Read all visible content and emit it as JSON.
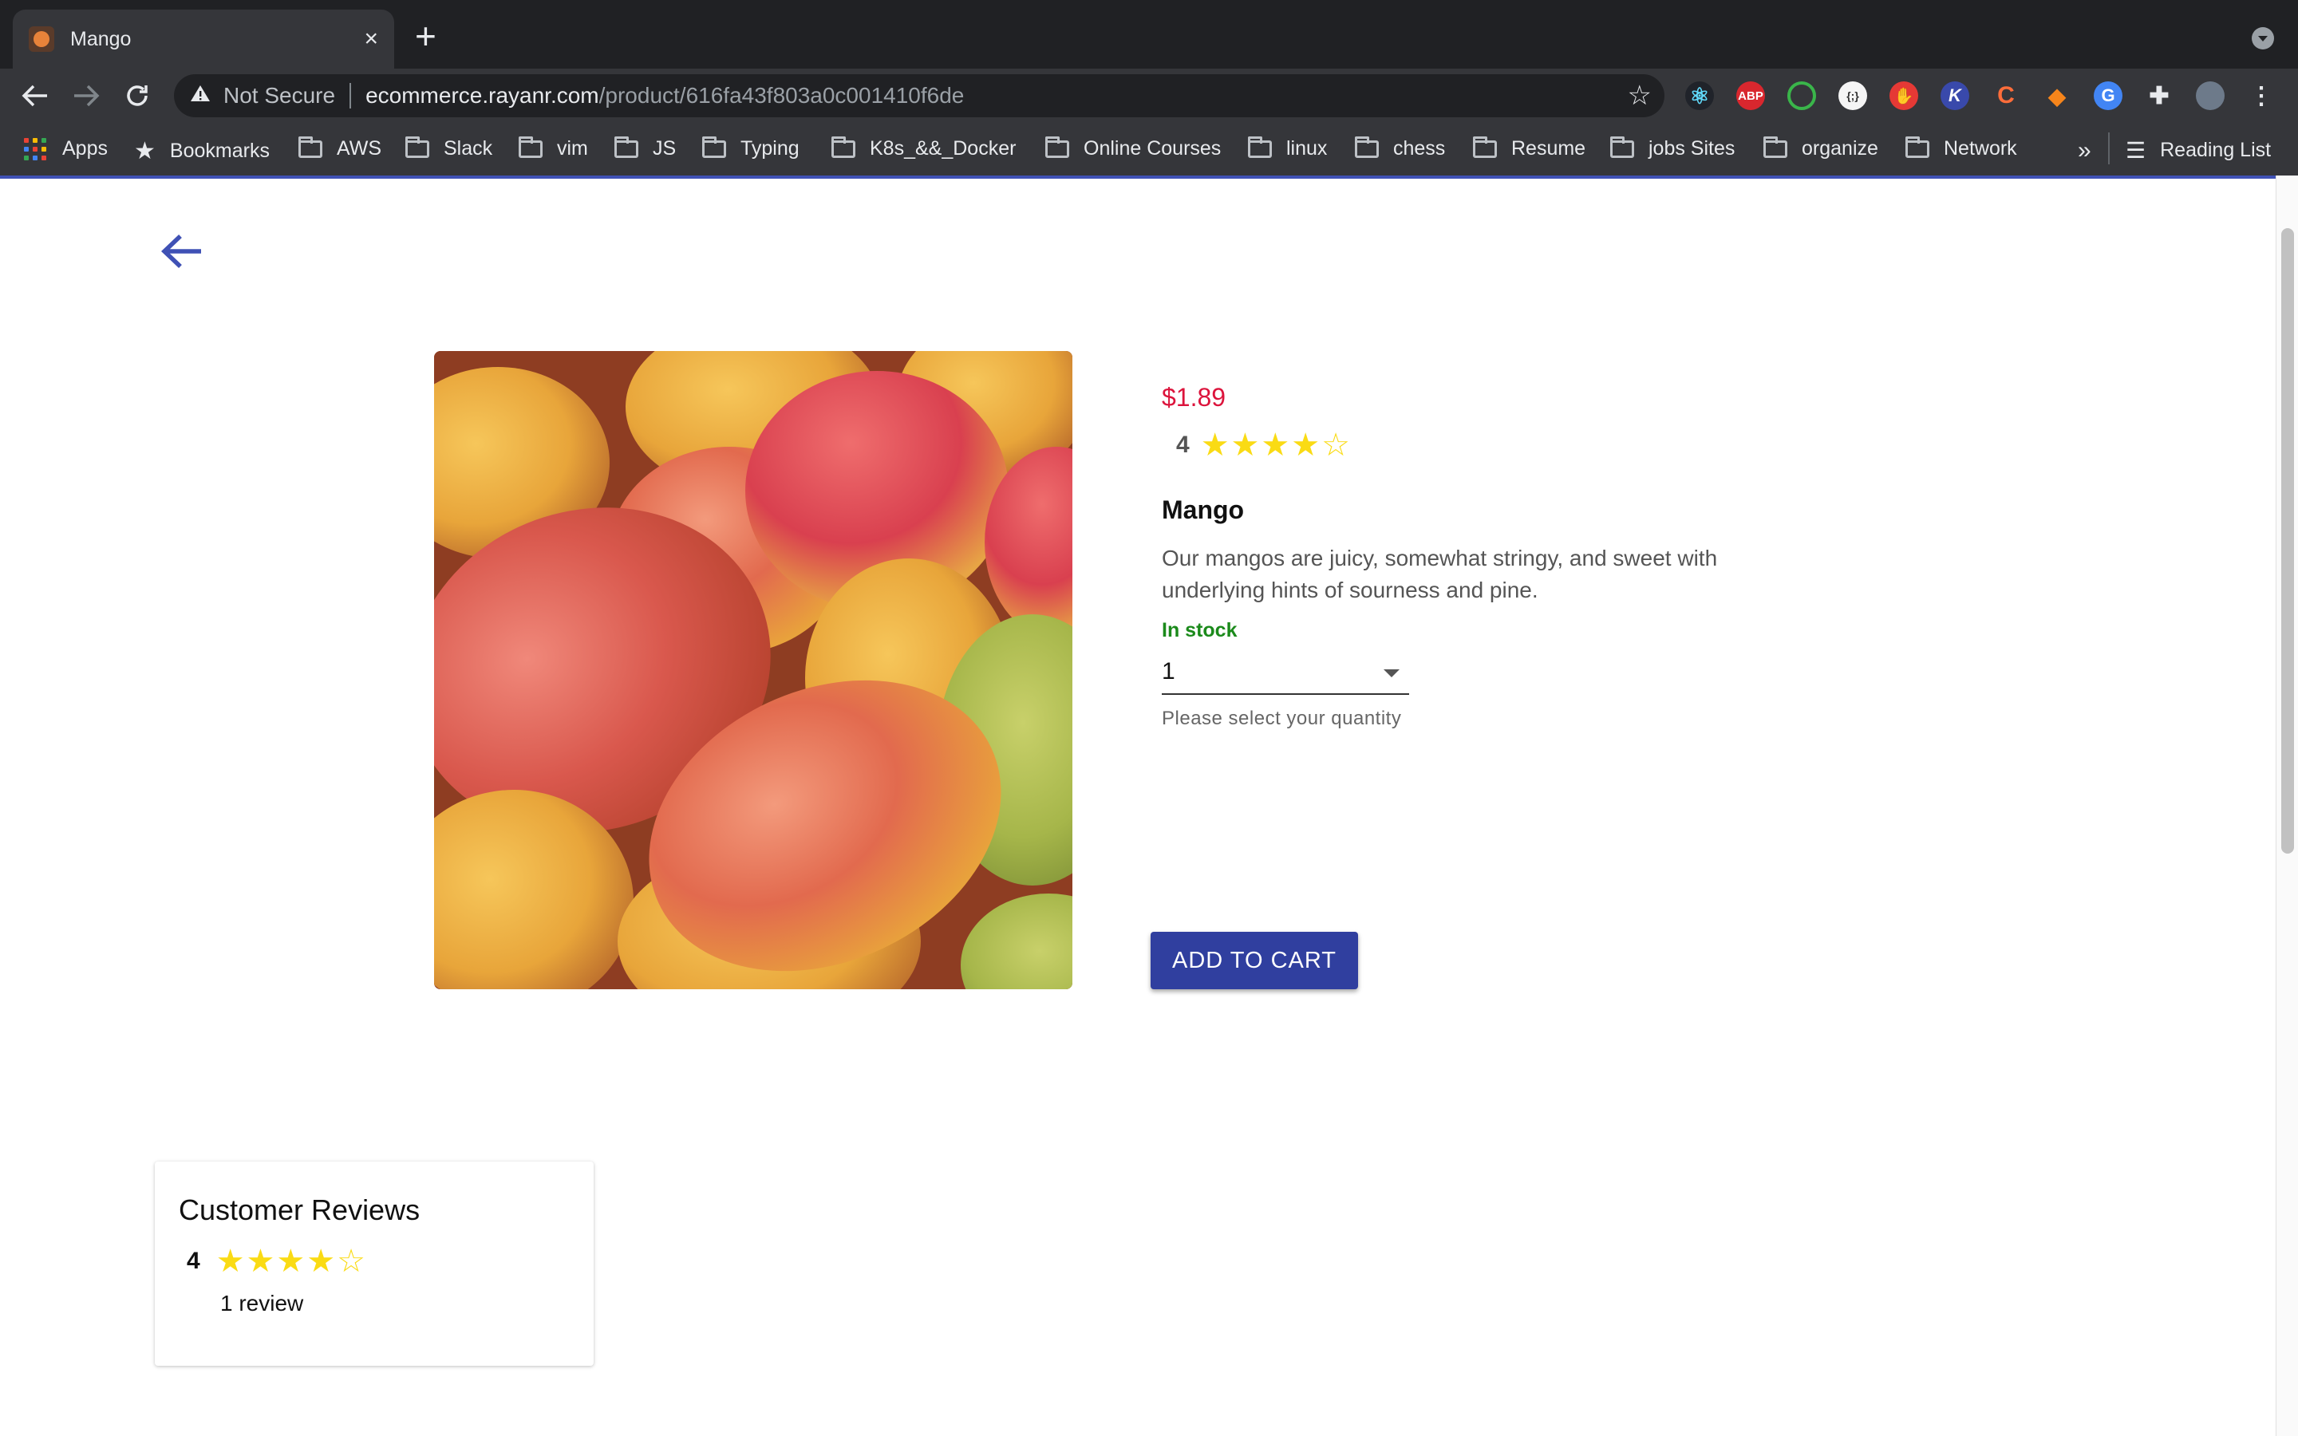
{
  "browser": {
    "tab_title": "Mango",
    "tab_close": "×",
    "new_tab": "+",
    "security_label": "Not Secure",
    "url_host": "ecommerce.rayanr.com",
    "url_path": "/product/616fa43f803a0c001410f6de",
    "bookmarks": {
      "apps": "Apps",
      "bookmarks": "Bookmarks",
      "folders": [
        "AWS",
        "Slack",
        "vim",
        "JS",
        "Typing",
        "K8s_&&_Docker",
        "Online Courses",
        "linux",
        "chess",
        "Resume",
        "jobs Sites",
        "organize",
        "Network"
      ],
      "overflow": "»",
      "reading_list": "Reading List"
    },
    "extensions": [
      "react-devtools-icon",
      "adblock-plus-icon",
      "green-ring-icon",
      "graphql-icon",
      "red-hand-icon",
      "k-icon",
      "c-icon",
      "metamask-fox-icon",
      "google-g-icon",
      "puzzle-icon",
      "profile-avatar"
    ],
    "extension_labels": {
      "adblock": "ABP",
      "k": "K",
      "c": "C",
      "g": "G"
    }
  },
  "product": {
    "price": "$1.89",
    "rating": "4",
    "rating_value": 4,
    "rating_max": 5,
    "stars": "★★★★☆",
    "name": "Mango",
    "description": "Our mangos are juicy, somewhat stringy, and sweet with underlying hints of sourness and pine.",
    "stock": "In stock",
    "quantity": "1",
    "quantity_helper": "Please select your quantity",
    "add_to_cart": "ADD TO CART",
    "image_alt": "mango-image"
  },
  "reviews": {
    "title": "Customer Reviews",
    "rating": "4",
    "stars": "★★★★☆",
    "count": "1 review"
  },
  "colors": {
    "accent": "#3f51b5",
    "button": "#303f9f",
    "price": "#dc143c",
    "stock": "#1b8a1b",
    "star": "#fadb14"
  }
}
